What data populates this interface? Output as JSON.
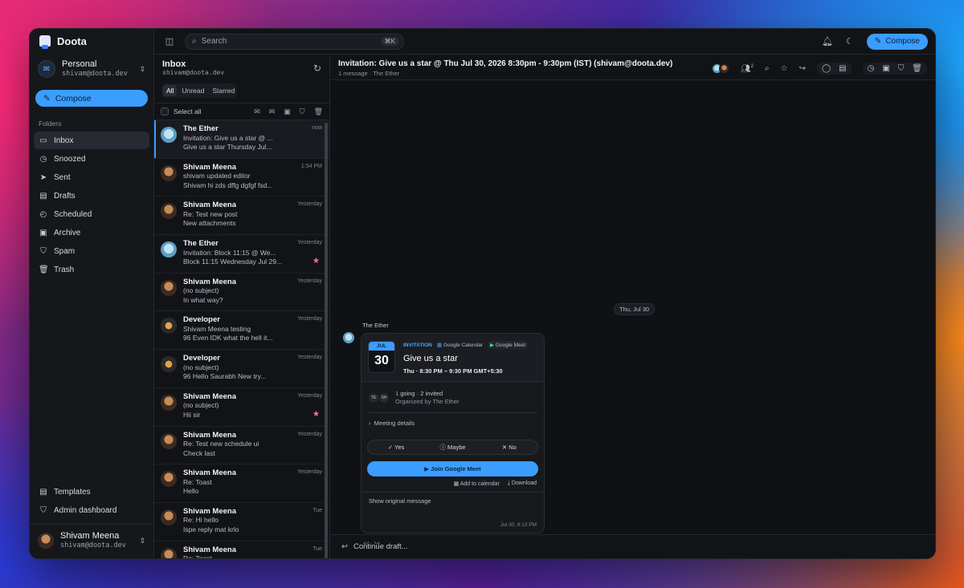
{
  "brand": {
    "name": "Doota"
  },
  "account": {
    "name": "Personal",
    "email": "shivam@doota.dev"
  },
  "sidebar": {
    "compose_label": "Compose",
    "folders_label": "Folders",
    "folders": [
      {
        "label": "Inbox",
        "icon": "inbox-icon",
        "glyph": "▭"
      },
      {
        "label": "Snoozed",
        "icon": "alarm-icon",
        "glyph": "◷"
      },
      {
        "label": "Sent",
        "icon": "send-icon",
        "glyph": "➤"
      },
      {
        "label": "Drafts",
        "icon": "file-icon",
        "glyph": "▤"
      },
      {
        "label": "Scheduled",
        "icon": "clock-icon",
        "glyph": "◴"
      },
      {
        "label": "Archive",
        "icon": "archive-icon",
        "glyph": "▣"
      },
      {
        "label": "Spam",
        "icon": "shield-icon",
        "glyph": "⛉"
      },
      {
        "label": "Trash",
        "icon": "trash-icon",
        "glyph": "🗑"
      }
    ],
    "bottom": [
      {
        "label": "Templates",
        "icon": "template-icon",
        "glyph": "▤"
      },
      {
        "label": "Admin dashboard",
        "icon": "shield-icon",
        "glyph": "⛉"
      }
    ],
    "user": {
      "name": "Shivam Meena",
      "email": "shivam@doota.dev"
    }
  },
  "topbar": {
    "search_placeholder": "Search",
    "shortcut": "⌘K",
    "compose_label": "Compose"
  },
  "inbox": {
    "title": "Inbox",
    "email": "shivam@doota.dev",
    "tabs": [
      "All",
      "Unread",
      "Starred"
    ],
    "select_all": "Select all",
    "rows": [
      {
        "sender": "The Ether",
        "subject": "Invitation: Give us a star @ ...",
        "preview": "Give us a star Thursday Jul...",
        "time": "now",
        "avatar": "ether",
        "starred": false,
        "selected": true
      },
      {
        "sender": "Shivam Meena",
        "subject": "shivam updated editor",
        "preview": "Shivam hi zds dffg dgfgf fsd...",
        "time": "1:54 PM",
        "avatar": "shivam",
        "starred": false,
        "selected": false
      },
      {
        "sender": "Shivam Meena",
        "subject": "Re: Test new post",
        "preview": "New attachments",
        "time": "Yesterday",
        "avatar": "shivam",
        "starred": false,
        "selected": false
      },
      {
        "sender": "The Ether",
        "subject": "Invitation: Block 11:15 @ We...",
        "preview": "Block 11:15 Wednesday Jul 29...",
        "time": "Yesterday",
        "avatar": "ether",
        "starred": true,
        "selected": false
      },
      {
        "sender": "Shivam Meena",
        "subject": "(no subject)",
        "preview": "In what way?",
        "time": "Yesterday",
        "avatar": "shivam",
        "starred": false,
        "selected": false
      },
      {
        "sender": "Developer",
        "subject": "Shivam Meena testing",
        "preview": "96 Even IDK what the hell it...",
        "time": "Yesterday",
        "avatar": "dev",
        "starred": false,
        "selected": false
      },
      {
        "sender": "Developer",
        "subject": "(no subject)",
        "preview": "96 Hello Saurabh New try...",
        "time": "Yesterday",
        "avatar": "dev",
        "starred": false,
        "selected": false
      },
      {
        "sender": "Shivam Meena",
        "subject": "(no subject)",
        "preview": "Hii sir",
        "time": "Yesterday",
        "avatar": "shivam",
        "starred": true,
        "selected": false
      },
      {
        "sender": "Shivam Meena",
        "subject": "Re: Test new schedule ui",
        "preview": "Check last",
        "time": "Yesterday",
        "avatar": "shivam",
        "starred": false,
        "selected": false
      },
      {
        "sender": "Shivam Meena",
        "subject": "Re: Toast",
        "preview": "Hello",
        "time": "Yesterday",
        "avatar": "shivam",
        "starred": false,
        "selected": false
      },
      {
        "sender": "Shivam Meena",
        "subject": "Re: Hi hello",
        "preview": "Ispe reply mat krlo",
        "time": "Tue",
        "avatar": "shivam",
        "starred": false,
        "selected": false
      },
      {
        "sender": "Shivam Meena",
        "subject": "Re: Toast",
        "preview": "",
        "time": "Tue",
        "avatar": "shivam",
        "starred": false,
        "selected": false
      }
    ]
  },
  "conversation": {
    "title": "Invitation: Give us a star @ Thu Jul 30, 2026 8:30pm - 9:30pm (IST) (shivam@doota.dev)",
    "subtitle": "1 message · The Ether",
    "participants_count": "2",
    "date_chip": "Thu, Jul 30",
    "sender": "The Ether",
    "invite": {
      "month": "JUL",
      "day": "30",
      "label": "INVITATION",
      "calendar": "Google Calendar",
      "meet": "Google Meet",
      "title": "Give us a star",
      "time": "Thu · 8:30 PM – 9:30 PM GMT+5:30",
      "initials": [
        "TE",
        "SH"
      ],
      "going_count": "1",
      "going_rest": " going · 2 invited",
      "organizer": "Organized by The Ether",
      "details": "Meeting details",
      "rsvp": {
        "yes": "Yes",
        "maybe": "Maybe",
        "no": "No"
      },
      "join": "Join Google Meet",
      "add_calendar": "Add to calendar",
      "download": "Download",
      "show_original": "Show original message",
      "timestamp": "Jul 30, 8:13 PM"
    },
    "draft": "Continue draft..."
  },
  "colors": {
    "accent": "#3b9dff",
    "star": "#ff6fa9",
    "green": "#3ddc84"
  }
}
